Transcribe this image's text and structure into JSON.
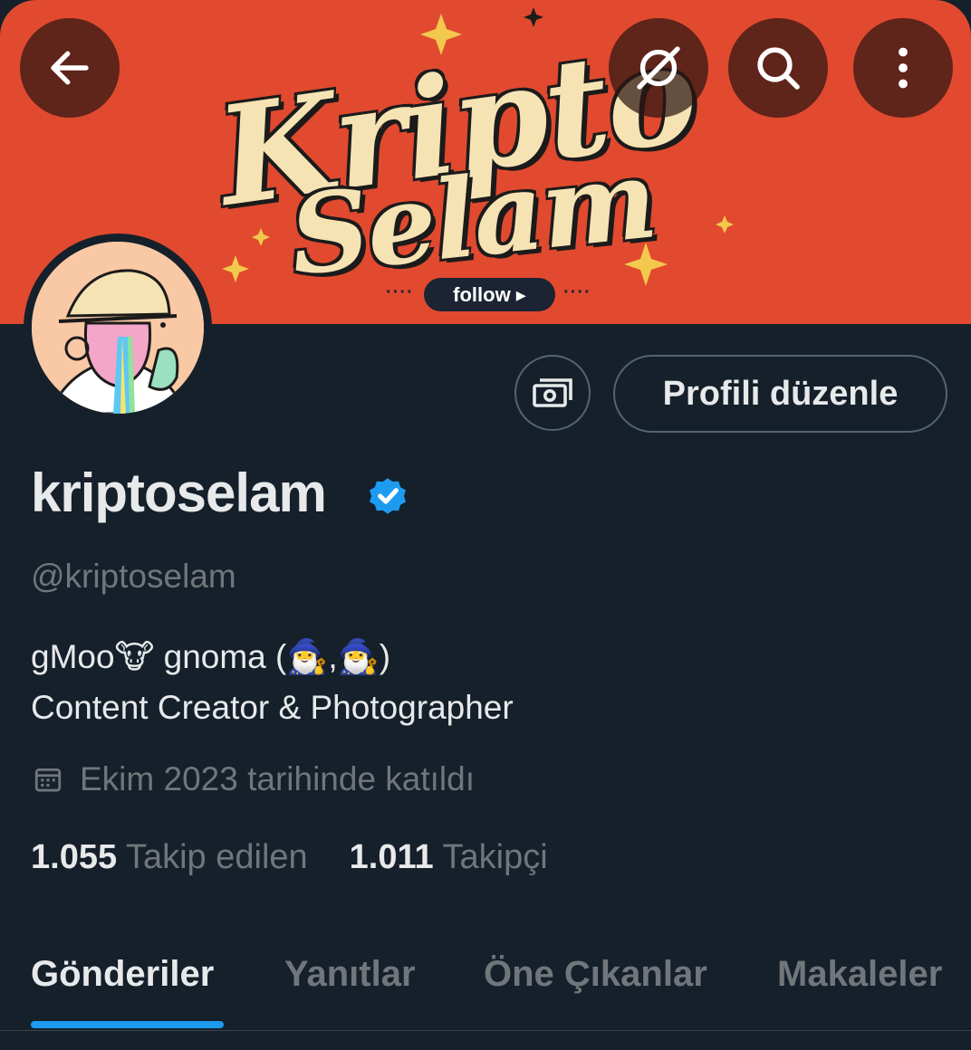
{
  "header": {
    "banner_brand_line1": "Kripto",
    "banner_brand_line2": "Selam",
    "banner_follow_label": "follow ▸",
    "banner_dots": "····",
    "buttons": [
      "back",
      "grok",
      "search",
      "more"
    ]
  },
  "profile": {
    "display_name": "kriptoselam",
    "handle": "@kriptoselam",
    "bio_line1": "gMoo🐮 gnoma (🧙‍♂️,🧙‍♂️)",
    "bio_line2": "Content Creator & Photographer",
    "joined": "Ekim 2023 tarihinde katıldı",
    "edit_button": "Profili düzenle",
    "following_count": "1.055",
    "following_label": "Takip edilen",
    "followers_count": "1.011",
    "followers_label": "Takipçi"
  },
  "tabs": [
    {
      "label": "Gönderiler",
      "active": true
    },
    {
      "label": "Yanıtlar",
      "active": false
    },
    {
      "label": "Öne Çıkanlar",
      "active": false
    },
    {
      "label": "Makaleler",
      "active": false
    }
  ],
  "colors": {
    "background": "#15202b",
    "banner": "#e14a2f",
    "accent": "#1d9bf0",
    "secondary_text": "#71767b"
  }
}
